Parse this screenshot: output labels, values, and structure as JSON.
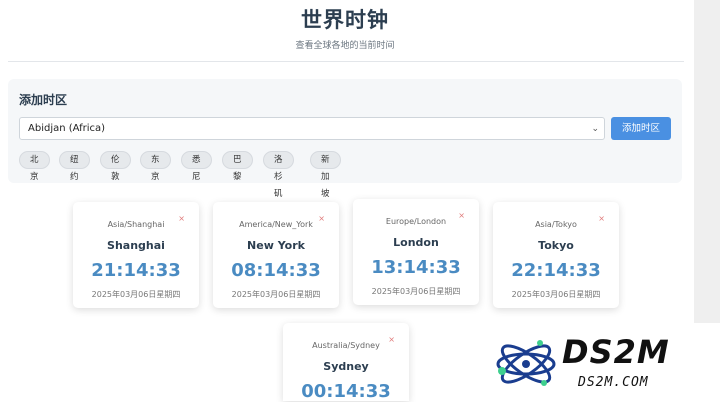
{
  "header": {
    "title": "世界时钟",
    "subtitle": "查看全球各地的当前时间"
  },
  "add_panel": {
    "title": "添加时区",
    "select_value": "Abidjan (Africa)",
    "add_button": "添加时区",
    "quick_chips": [
      "北京",
      "纽约",
      "伦敦",
      "东京",
      "悉尼",
      "巴黎",
      "洛杉矶",
      "新加坡"
    ]
  },
  "clocks": [
    {
      "zone": "Asia/Shanghai",
      "city": "Shanghai",
      "time": "21:14:33",
      "date": "2025年03月06日星期四"
    },
    {
      "zone": "America/New_York",
      "city": "New York",
      "time": "08:14:33",
      "date": "2025年03月06日星期四"
    },
    {
      "zone": "Europe/London",
      "city": "London",
      "time": "13:14:33",
      "date": "2025年03月06日星期四"
    },
    {
      "zone": "Asia/Tokyo",
      "city": "Tokyo",
      "time": "22:14:33",
      "date": "2025年03月06日星期四"
    },
    {
      "zone": "Australia/Sydney",
      "city": "Sydney",
      "time": "00:14:33",
      "date": ""
    }
  ],
  "close_symbol": "×",
  "watermark": {
    "logo": "DS2M",
    "sub": "DS2M.COM"
  },
  "colors": {
    "accent": "#4a90e2",
    "time": "#4a8bc2",
    "close": "#e07b7b"
  }
}
